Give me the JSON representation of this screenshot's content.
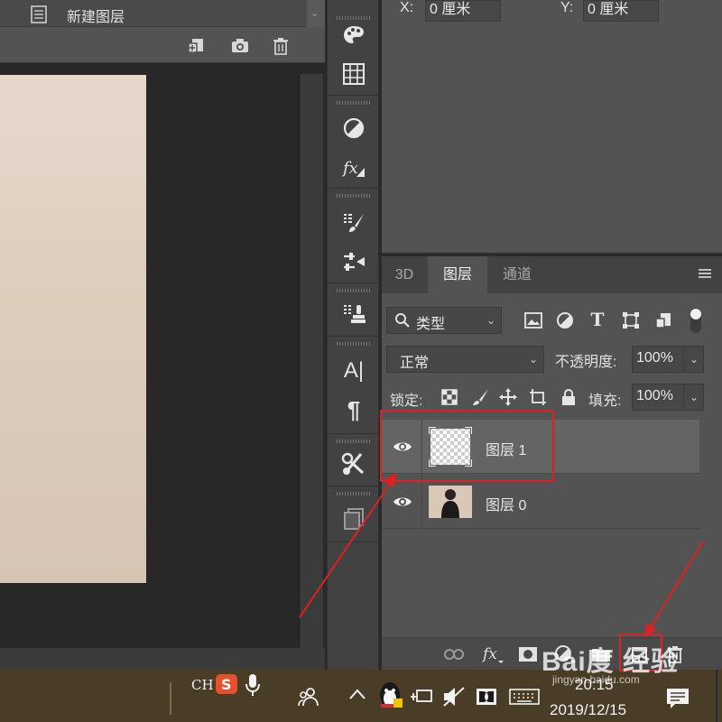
{
  "history": {
    "item_label": "新建图层"
  },
  "properties": {
    "x_label": "X:",
    "x_value": "0 厘米",
    "y_label": "Y:",
    "y_value": "0 厘米"
  },
  "layers_panel": {
    "tabs": [
      {
        "label": "3D"
      },
      {
        "label": "图层"
      },
      {
        "label": "通道"
      }
    ],
    "active_tab": "图层",
    "filter": {
      "value": "类型"
    },
    "blend_mode": {
      "value": "正常"
    },
    "opacity": {
      "label": "不透明度:",
      "value": "100%"
    },
    "lock": {
      "label": "锁定:"
    },
    "fill": {
      "label": "填充:",
      "value": "100%"
    },
    "layers": [
      {
        "name": "图层 1",
        "visible": true,
        "selected": true
      },
      {
        "name": "图层 0",
        "visible": true,
        "selected": false
      }
    ],
    "bottom_icons": [
      "link-icon",
      "fx-icon",
      "mask-icon",
      "adjustment-icon",
      "group-folder-icon",
      "new-layer-icon",
      "trash-icon"
    ]
  },
  "tool_strip": {
    "icons": [
      "palette-icon",
      "grid-icon",
      "adjustments-icon",
      "fx-icon",
      "brush-presets-icon",
      "brush-settings-icon",
      "clone-source-icon",
      "character-icon",
      "paragraph-icon",
      "tool-presets-icon",
      "copy-source-icon"
    ],
    "character_glyph": "A|",
    "paragraph_glyph": "¶"
  },
  "taskbar": {
    "ime_label": "CH",
    "time": "20:15",
    "date": "2019/12/15"
  },
  "watermark": "Bai度 经验",
  "watermark_url": "jingyan.baidu.com",
  "colors": {
    "panel_bg": "#535353",
    "dark_bg": "#282828",
    "annotation_red": "#e02020",
    "taskbar_bg": "#4a3d27"
  }
}
